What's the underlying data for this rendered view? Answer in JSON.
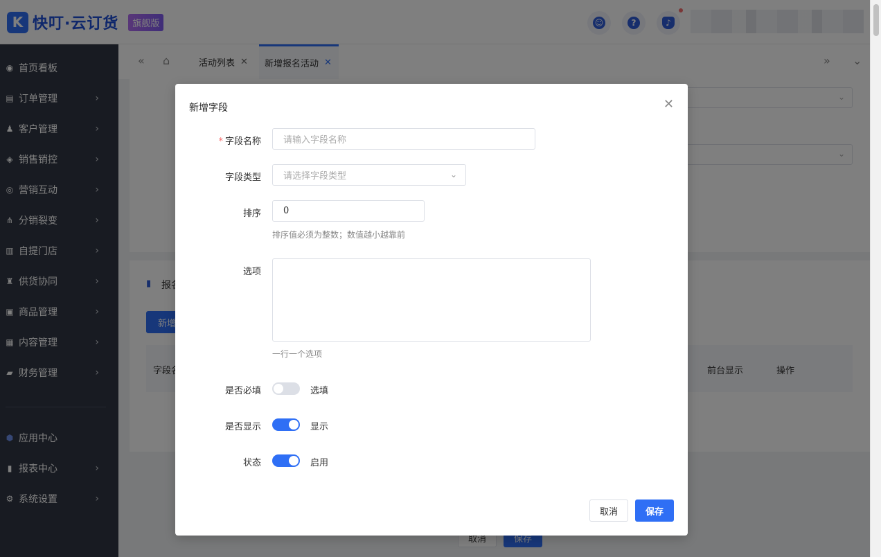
{
  "header": {
    "logo_mark": "K",
    "logo_text": "快叮·云订货",
    "edition_badge": "旗舰版",
    "icons": [
      "service-icon",
      "help-icon",
      "bell-icon"
    ]
  },
  "sidebar": {
    "items": [
      {
        "label": "首页看板",
        "icon": "dashboard-icon",
        "has_children": false
      },
      {
        "label": "订单管理",
        "icon": "order-icon",
        "has_children": true
      },
      {
        "label": "客户管理",
        "icon": "customer-icon",
        "has_children": true
      },
      {
        "label": "销售销控",
        "icon": "tag-icon",
        "has_children": true
      },
      {
        "label": "营销互动",
        "icon": "target-icon",
        "has_children": true
      },
      {
        "label": "分销裂变",
        "icon": "network-icon",
        "has_children": true
      },
      {
        "label": "自提门店",
        "icon": "store-icon",
        "has_children": true
      },
      {
        "label": "供货协同",
        "icon": "supplier-icon",
        "has_children": true
      },
      {
        "label": "商品管理",
        "icon": "goods-icon",
        "has_children": true
      },
      {
        "label": "内容管理",
        "icon": "content-icon",
        "has_children": true
      },
      {
        "label": "财务管理",
        "icon": "finance-icon",
        "has_children": true
      },
      {
        "label": "应用中心",
        "icon": "app-icon",
        "has_children": false
      },
      {
        "label": "报表中心",
        "icon": "chart-icon",
        "has_children": true
      },
      {
        "label": "系统设置",
        "icon": "gear-icon",
        "has_children": true
      }
    ]
  },
  "tabs": [
    {
      "label": "活动列表",
      "active": false
    },
    {
      "label": "新增报名活动",
      "active": true
    }
  ],
  "background": {
    "section_title": "报名",
    "add_button": "新增",
    "table_headers": [
      "字段名",
      "前台显示",
      "操作"
    ],
    "footer_cancel": "取消",
    "footer_save": "保存"
  },
  "modal": {
    "title": "新增字段",
    "fields": {
      "name": {
        "label": "字段名称",
        "required": true,
        "placeholder": "请输入字段名称"
      },
      "type": {
        "label": "字段类型",
        "placeholder": "请选择字段类型"
      },
      "sort": {
        "label": "排序",
        "value": "0",
        "hint": "排序值必须为整数；数值越小越靠前"
      },
      "options": {
        "label": "选项",
        "value": "",
        "hint": "一行一个选项"
      },
      "required": {
        "label": "是否必填",
        "state_text": "选填",
        "on": false
      },
      "visible": {
        "label": "是否显示",
        "state_text": "显示",
        "on": true
      },
      "status": {
        "label": "状态",
        "state_text": "启用",
        "on": true
      }
    },
    "cancel_label": "取消",
    "save_label": "保存"
  },
  "colors": {
    "primary": "#2f6ff5",
    "sidebar_bg": "#303744",
    "required_mark": "#f56c6c"
  }
}
